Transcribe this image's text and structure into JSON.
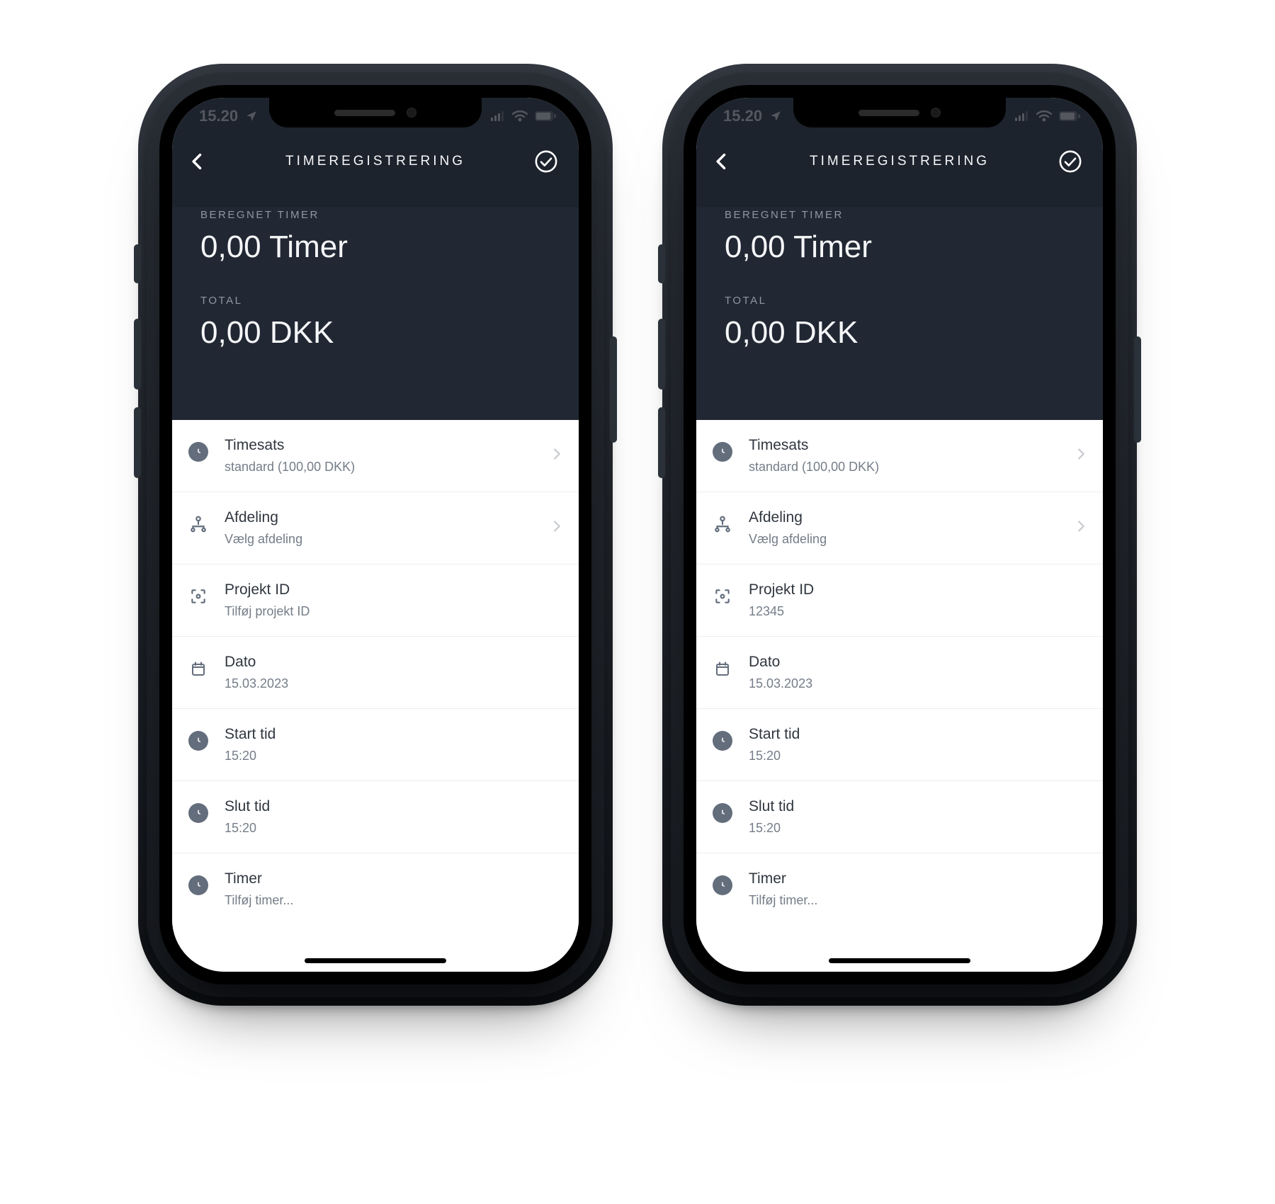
{
  "statusbar": {
    "time": "15.20"
  },
  "navbar": {
    "title": "TIMEREGISTRERING"
  },
  "summary": {
    "calc_label": "BEREGNET TIMER",
    "calc_value": "0,00 Timer",
    "total_label": "TOTAL",
    "total_value": "0,00 DKK"
  },
  "phone_left": {
    "rows": {
      "timesats": {
        "title": "Timesats",
        "sub": "standard  (100,00 DKK)"
      },
      "afdeling": {
        "title": "Afdeling",
        "sub": "Vælg afdeling"
      },
      "projekt": {
        "title": "Projekt ID",
        "sub": "Tilføj projekt ID"
      },
      "dato": {
        "title": "Dato",
        "sub": "15.03.2023"
      },
      "start": {
        "title": "Start tid",
        "sub": "15:20"
      },
      "slut": {
        "title": "Slut tid",
        "sub": "15:20"
      },
      "timer": {
        "title": "Timer",
        "sub": "Tilføj timer..."
      }
    }
  },
  "phone_right": {
    "rows": {
      "timesats": {
        "title": "Timesats",
        "sub": "standard  (100,00 DKK)"
      },
      "afdeling": {
        "title": "Afdeling",
        "sub": "Vælg afdeling"
      },
      "projekt": {
        "title": "Projekt ID",
        "sub": "12345"
      },
      "dato": {
        "title": "Dato",
        "sub": "15.03.2023"
      },
      "start": {
        "title": "Start tid",
        "sub": "15:20"
      },
      "slut": {
        "title": "Slut tid",
        "sub": "15:20"
      },
      "timer": {
        "title": "Timer",
        "sub": "Tilføj timer..."
      }
    }
  }
}
